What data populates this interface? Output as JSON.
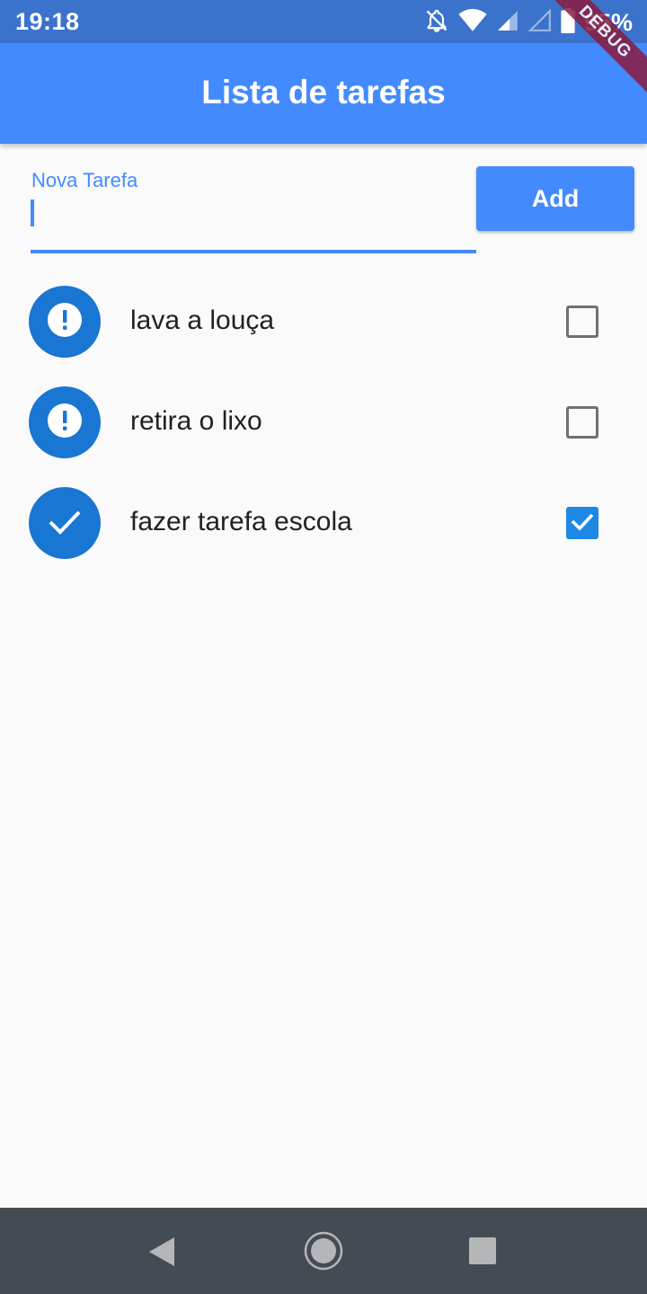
{
  "status_bar": {
    "time": "19:18",
    "battery": "95%",
    "icons": [
      "bell-off-icon",
      "wifi-icon",
      "signal-icon",
      "signal-empty-icon",
      "battery-icon"
    ]
  },
  "debug_banner": "DEBUG",
  "app_bar": {
    "title": "Lista de tarefas"
  },
  "new_task": {
    "label": "Nova Tarefa",
    "value": "",
    "add_label": "Add"
  },
  "tasks": [
    {
      "label": "lava a louça",
      "done": false,
      "icon": "exclamation-icon"
    },
    {
      "label": "retira o lixo",
      "done": false,
      "icon": "exclamation-icon"
    },
    {
      "label": "fazer tarefa escola",
      "done": true,
      "icon": "check-icon"
    }
  ],
  "nav_bar": {
    "icons": [
      "back-icon",
      "home-icon",
      "recents-icon"
    ]
  },
  "colors": {
    "status_bar": "#3a72cc",
    "app_bar": "#448aff",
    "accent": "#1976d2",
    "background": "#fafafa",
    "nav_bar": "#454b52"
  }
}
